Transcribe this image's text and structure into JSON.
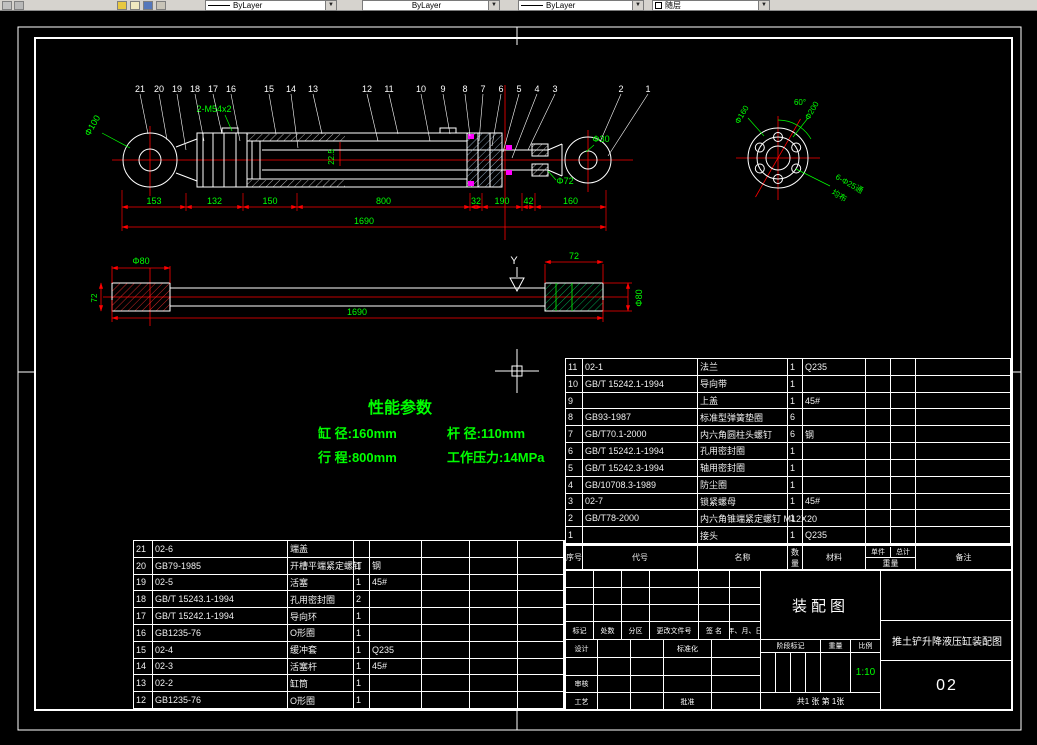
{
  "toolbar": {
    "linetype_combo": "ByLayer",
    "lineweight_combo": "ByLayer",
    "plotstyle_combo": "ByLayer",
    "color_combo": "随层"
  },
  "performance": {
    "title": "性能参数",
    "bore": "缸 径:160mm",
    "rod": "杆 径:110mm",
    "stroke": "行 程:800mm",
    "pressure": "工作压力:14MPa"
  },
  "main_view": {
    "part_numbers": [
      "21",
      "20",
      "19",
      "18",
      "17",
      "16",
      "15",
      "14",
      "13",
      "12",
      "11",
      "10",
      "9",
      "8",
      "7",
      "6",
      "5",
      "4",
      "3",
      "2",
      "1"
    ],
    "callout_eye_bore": "Φ100",
    "callout_thread": "2-M54x2",
    "callout_22_5": "22.5",
    "callout_rod_dia": "Φ72",
    "callout_pin_bore": "Φ30",
    "dim_chain": [
      "153",
      "132",
      "150",
      "800",
      "32",
      "190",
      "42",
      "160"
    ],
    "dim_total": "1690"
  },
  "side_view": {
    "dim_phi80_left": "Φ80",
    "dim_72_left": "72",
    "dim_72_right": "72",
    "dim_phi80_right": "Φ80",
    "dim_total": "1690",
    "section_label": "Y"
  },
  "flange_view": {
    "dim_bolt_circle": "Φ160",
    "dim_outer": "Φ200",
    "dim_angle": "60°",
    "dim_holes": "6-Φ25通",
    "dim_holes2": "均布"
  },
  "bom_right": {
    "header": {
      "no": "序号",
      "code": "代号",
      "name": "名称",
      "qty": "数量",
      "material": "材料",
      "unit": "单件",
      "total": "总计",
      "weight": "重量",
      "remark": "备注"
    },
    "rows": [
      [
        "11",
        "02-1",
        "法兰",
        "1",
        "Q235"
      ],
      [
        "10",
        "GB/T 15242.1-1994",
        "导向带",
        "1",
        ""
      ],
      [
        "9",
        "",
        "上盖",
        "1",
        "45#"
      ],
      [
        "8",
        "GB93-1987",
        "标准型弹簧垫圈",
        "6",
        ""
      ],
      [
        "7",
        "GB/T70.1-2000",
        "内六角圆柱头螺钉",
        "6",
        "钢"
      ],
      [
        "6",
        "GB/T 15242.1-1994",
        "孔用密封圈",
        "1",
        ""
      ],
      [
        "5",
        "GB/T 15242.3-1994",
        "轴用密封圈",
        "1",
        ""
      ],
      [
        "4",
        "GB/10708.3-1989",
        "防尘圈",
        "1",
        ""
      ],
      [
        "3",
        "02-7",
        "锁紧螺母",
        "1",
        "45#"
      ],
      [
        "2",
        "GB/T78-2000",
        "内六角锥端紧定螺钉 M12X20",
        "1",
        ""
      ],
      [
        "1",
        "",
        "接头",
        "1",
        "Q235"
      ]
    ]
  },
  "bom_left": {
    "rows": [
      [
        "21",
        "02-6",
        "端盖",
        "",
        ""
      ],
      [
        "20",
        "GB79-1985",
        "开槽平端紧定螺钉",
        "1",
        "钢"
      ],
      [
        "19",
        "02-5",
        "活塞",
        "1",
        "45#"
      ],
      [
        "18",
        "GB/T 15243.1-1994",
        "孔用密封圈",
        "2",
        ""
      ],
      [
        "17",
        "GB/T 15242.1-1994",
        "导向环",
        "1",
        ""
      ],
      [
        "16",
        "GB1235-76",
        "O形圈",
        "1",
        ""
      ],
      [
        "15",
        "02-4",
        "缓冲套",
        "1",
        "Q235"
      ],
      [
        "14",
        "02-3",
        "活塞杆",
        "1",
        "45#"
      ],
      [
        "13",
        "02-2",
        "缸筒",
        "1",
        ""
      ],
      [
        "12",
        "GB1235-76",
        "O形圈",
        "1",
        ""
      ]
    ]
  },
  "title_block": {
    "type_label": "装配图",
    "drawing_title": "推土铲升降液压缸装配图",
    "drawing_no": "02",
    "scale": "1:10",
    "sheet": "共1 张 第 1张",
    "stage_label": "阶段标记",
    "weight_label": "重量",
    "scale_label": "比例",
    "row_labels": [
      "标记",
      "处数",
      "分区",
      "更改文件号",
      "签 名",
      "年、月、日"
    ],
    "design_label": "设计",
    "standard_label": "标准化",
    "check_label": "审核",
    "process_label": "工艺",
    "approve_label": "批准"
  }
}
